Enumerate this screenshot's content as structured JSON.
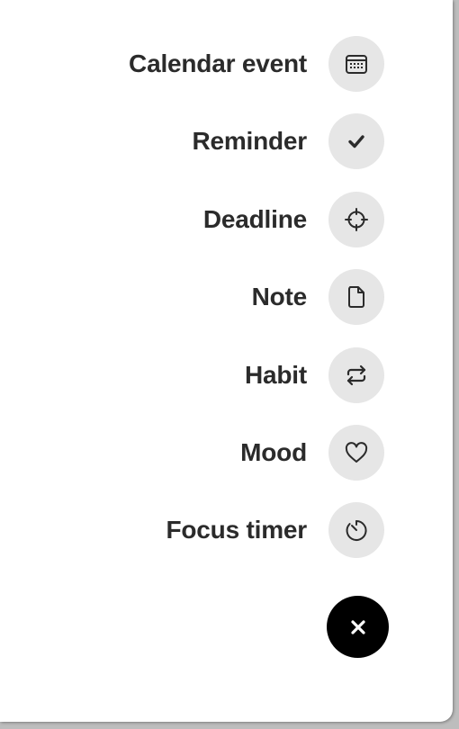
{
  "menu": {
    "items": [
      {
        "label": "Calendar event",
        "icon": "calendar-icon"
      },
      {
        "label": "Reminder",
        "icon": "checkmark-icon"
      },
      {
        "label": "Deadline",
        "icon": "crosshair-icon"
      },
      {
        "label": "Note",
        "icon": "document-icon"
      },
      {
        "label": "Habit",
        "icon": "repeat-icon"
      },
      {
        "label": "Mood",
        "icon": "heart-icon"
      },
      {
        "label": "Focus timer",
        "icon": "timer-icon"
      }
    ]
  },
  "close_button": {
    "icon": "close-icon"
  },
  "colors": {
    "background": "#ffffff",
    "icon_circle": "#e6e6e6",
    "label_text": "#2b2b2b",
    "fab": "#000000",
    "fab_icon": "#ffffff"
  }
}
